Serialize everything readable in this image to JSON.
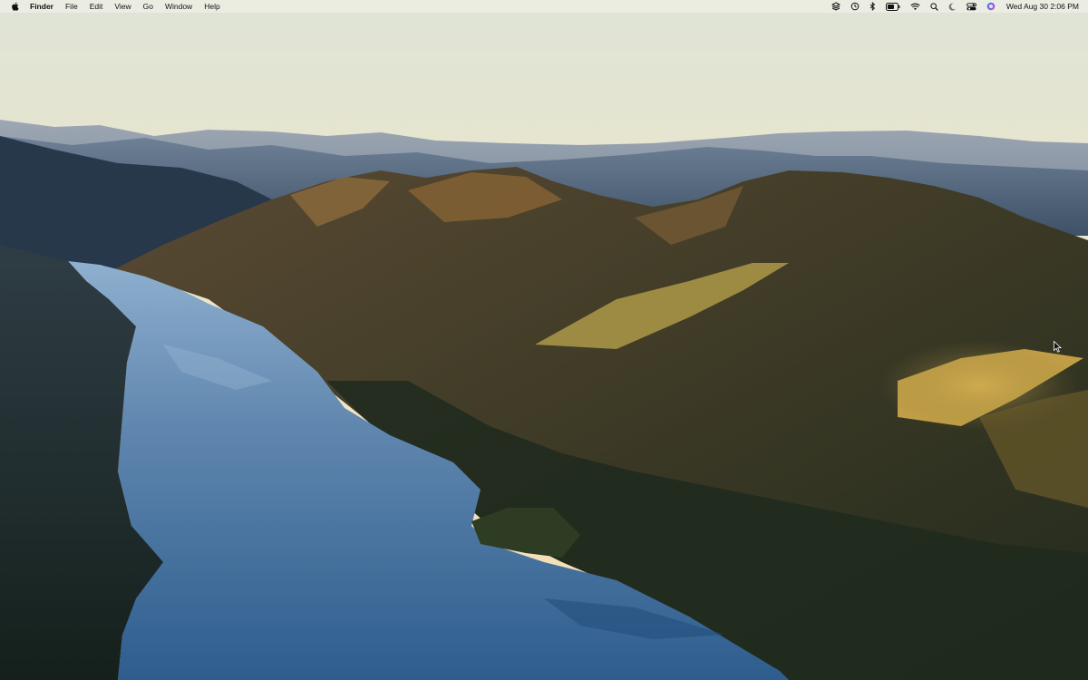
{
  "menubar": {
    "apple_icon": "apple-icon",
    "app_name": "Finder",
    "menus": [
      "File",
      "Edit",
      "View",
      "Go",
      "Window",
      "Help"
    ],
    "status_icons": [
      "stack-icon",
      "time-machine-icon",
      "bluetooth-icon",
      "battery-icon",
      "wifi-icon",
      "search-icon",
      "moon-icon",
      "control-center-icon",
      "siri-icon"
    ],
    "clock": "Wed Aug 30  2:06 PM"
  },
  "desktop": {
    "wallpaper": "landscape",
    "colors": {
      "sky_top": "#e4e6d8",
      "sky_bottom": "#f5dfb0",
      "lake": "#5b84ad",
      "forest": "#1f2a20",
      "sunlit_hill": "#c9a44a"
    }
  }
}
